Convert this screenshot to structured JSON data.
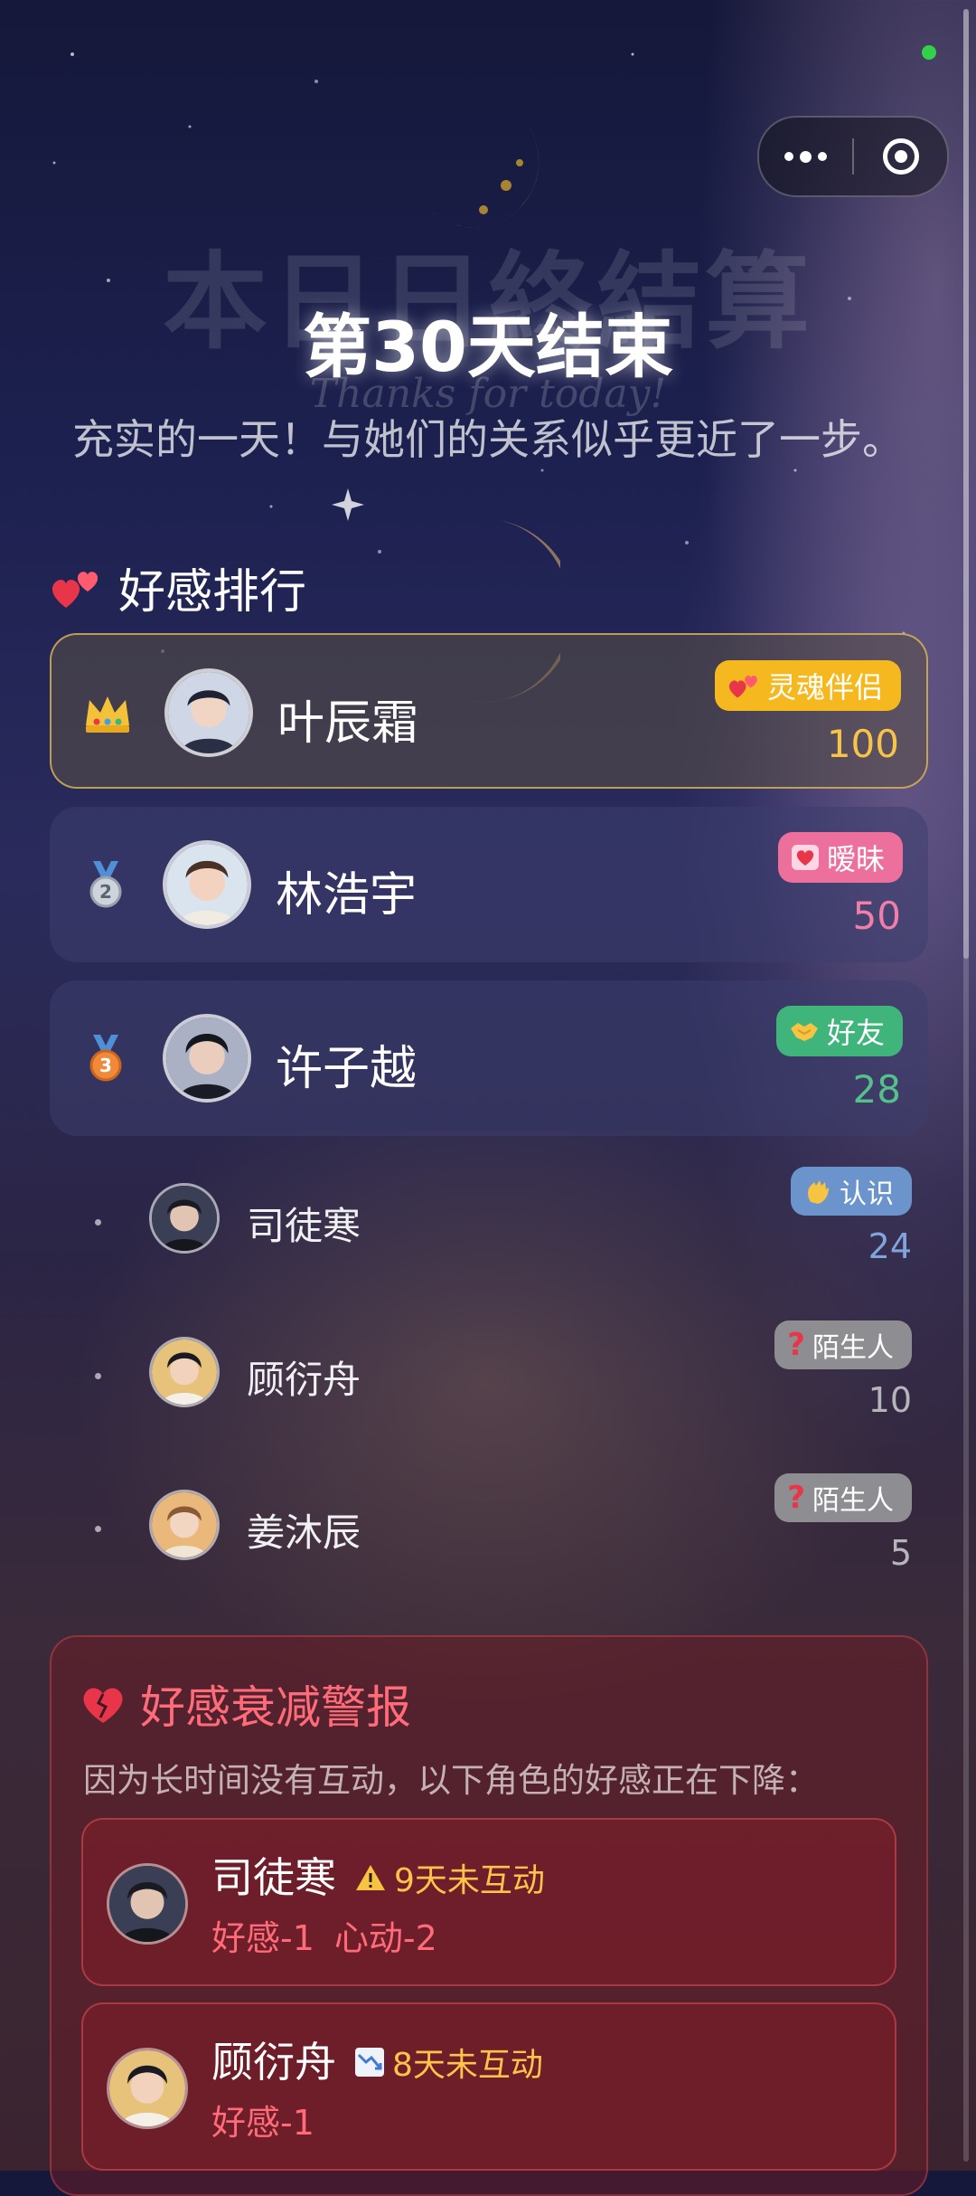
{
  "header": {
    "ghost_title": "本日日終結算",
    "ghost_subtitle": "Thanks for today!",
    "title": "第30天结束",
    "subtitle": "充实的一天！与她们的关系似乎更近了一步。"
  },
  "ranking": {
    "section_title": "好感排行",
    "top": [
      {
        "rank_icon": "crown-icon",
        "name": "叶辰霜",
        "badge": "灵魂伴侣",
        "badge_icon": "two-hearts-icon",
        "badge_color": "#f5b81e",
        "score": "100",
        "score_color": "#f7c447"
      },
      {
        "rank_icon": "medal-2-icon",
        "name": "林浩宇",
        "badge": "暧昧",
        "badge_icon": "heart-icon",
        "badge_color": "#ec6f9c",
        "score": "50",
        "score_color": "#ef7fa9"
      },
      {
        "rank_icon": "medal-3-icon",
        "name": "许子越",
        "badge": "好友",
        "badge_icon": "handshake-icon",
        "badge_color": "#3fb57c",
        "score": "28",
        "score_color": "#54c08b"
      }
    ],
    "others": [
      {
        "name": "司徒寒",
        "badge": "认识",
        "badge_icon": "waving-hand-icon",
        "badge_color": "#6c94cc",
        "score": "24",
        "score_color": "#7ea6dd"
      },
      {
        "name": "顾衍舟",
        "badge": "陌生人",
        "badge_icon": "question-icon",
        "badge_color": "#8e8e92",
        "score": "10",
        "score_color": "#b5b5bb"
      },
      {
        "name": "姜沐辰",
        "badge": "陌生人",
        "badge_icon": "question-icon",
        "badge_color": "#8e8e92",
        "score": "5",
        "score_color": "#b5b5bb"
      }
    ]
  },
  "decay_alert": {
    "title": "好感衰减警报",
    "description": "因为长时间没有互动，以下角色的好感正在下降：",
    "items": [
      {
        "name": "司徒寒",
        "warn_icon": "warning-icon",
        "warn_text": "9天未互动",
        "effects": [
          "好感-1",
          "心动-2"
        ]
      },
      {
        "name": "顾衍舟",
        "warn_icon": "chart-down-icon",
        "warn_text": "8天未互动",
        "effects": [
          "好感-1"
        ]
      }
    ]
  },
  "colors": {
    "accent_red": "#ff6b78",
    "warning_orange": "#ffc24a",
    "gold_border": "#e6be5a"
  }
}
